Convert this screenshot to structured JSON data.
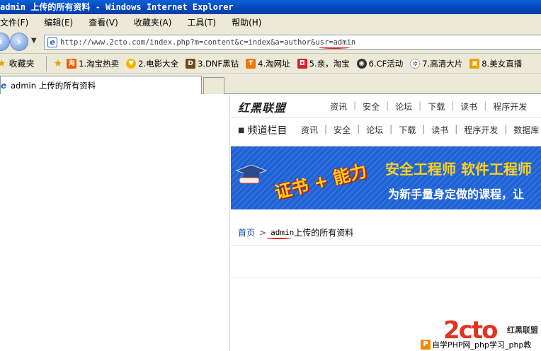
{
  "window": {
    "title": "admin 上传的所有资料 - Windows Internet Explorer"
  },
  "menu": [
    "文件(F)",
    "编辑(E)",
    "查看(V)",
    "收藏夹(A)",
    "工具(T)",
    "帮助(H)"
  ],
  "address": {
    "url": "http://www.2cto.com/index.php?m=content&c=index&a=author&usr=admin"
  },
  "favorites": {
    "label": "收藏夹",
    "items": [
      {
        "label": "1.淘宝热卖",
        "icon": "taobao-icon",
        "color": "#f25c05"
      },
      {
        "label": "2.电影大全",
        "icon": "heart-icon",
        "color": "#f2b705"
      },
      {
        "label": "3.DNF黑钻",
        "icon": "dnf-icon",
        "color": "#6b4a1a"
      },
      {
        "label": "4.淘网址",
        "icon": "t-icon",
        "color": "#f07800"
      },
      {
        "label": "5.亲，淘宝",
        "icon": "bag-icon",
        "color": "#d8202a"
      },
      {
        "label": "6.CF活动",
        "icon": "cf-icon",
        "color": "#333333"
      },
      {
        "label": "7.高清大片",
        "icon": "film-icon",
        "color": "#555555"
      },
      {
        "label": "8.美女直播",
        "icon": "tv-icon",
        "color": "#e8a200"
      }
    ]
  },
  "tab": {
    "title": "admin 上传的所有资料"
  },
  "site": {
    "logo": "红黑联盟",
    "topnav": [
      "资讯",
      "安全",
      "论坛",
      "下载",
      "读书",
      "程序开发"
    ],
    "channel_title": "频道栏目",
    "channel_nav": [
      "资讯",
      "安全",
      "论坛",
      "下载",
      "读书",
      "程序开发",
      "数据库"
    ],
    "banner": {
      "cert": "证书 + 能力",
      "line1": "安全工程师 软件工程师",
      "line2": "为新手量身定做的课程，让"
    },
    "breadcrumb": {
      "home": "首页",
      "separator": ">",
      "author": "admin",
      "suffix": "上传的所有资料"
    }
  },
  "watermark": {
    "logo": "2cto",
    "logo_cn": "红黑联盟",
    "strip": "自学PHP网_php学习_php教"
  },
  "colors": {
    "titlebar": "#0a5fd9",
    "chrome": "#ece9d8",
    "highlight_red": "#e0231a",
    "banner_blue": "#2c6fdd",
    "banner_yellow": "#ffd21a"
  }
}
